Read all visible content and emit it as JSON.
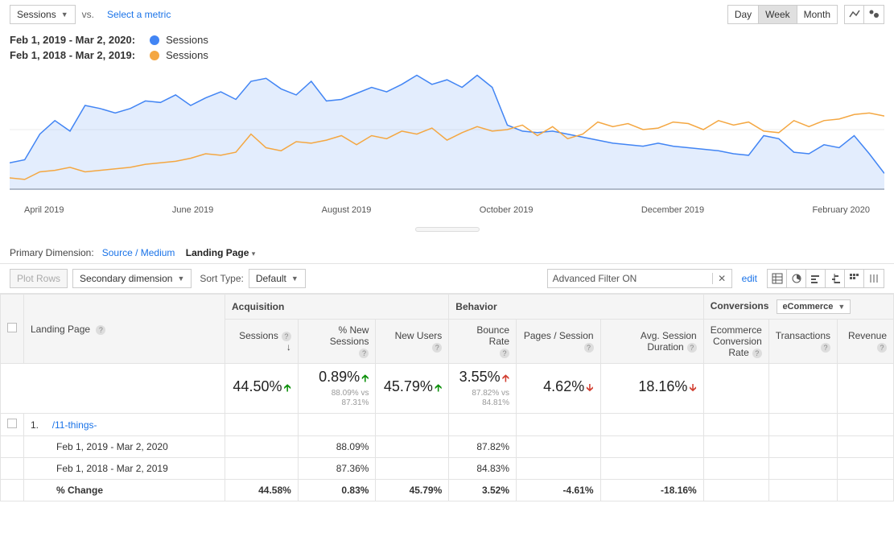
{
  "controls": {
    "metric_dropdown": "Sessions",
    "vs": "vs.",
    "select_metric": "Select a metric",
    "time": {
      "day": "Day",
      "week": "Week",
      "month": "Month",
      "active": "Week"
    }
  },
  "legend": {
    "range_a": "Feb 1, 2019 - Mar 2, 2020:",
    "range_b": "Feb 1, 2018 - Mar 2, 2019:",
    "label_a": "Sessions",
    "label_b": "Sessions",
    "color_a": "#4285f4",
    "color_b": "#f4a742"
  },
  "chart_data": {
    "type": "line",
    "x_ticks": [
      "April 2019",
      "June 2019",
      "August 2019",
      "October 2019",
      "December 2019",
      "February 2020"
    ],
    "series": [
      {
        "name": "Feb 1, 2019 - Mar 2, 2020",
        "color": "#4285f4",
        "values": [
          36,
          40,
          74,
          92,
          78,
          112,
          108,
          102,
          108,
          118,
          116,
          126,
          112,
          122,
          130,
          120,
          144,
          148,
          134,
          126,
          144,
          118,
          120,
          128,
          136,
          130,
          140,
          152,
          140,
          146,
          136,
          152,
          136,
          86,
          78,
          76,
          78,
          74,
          70,
          66,
          62,
          60,
          58,
          62,
          58,
          56,
          54,
          52,
          48,
          46,
          72,
          68,
          50,
          48,
          60,
          56,
          72,
          48,
          22
        ]
      },
      {
        "name": "Feb 1, 2018 - Mar 2, 2019",
        "color": "#f4a742",
        "values": [
          16,
          14,
          24,
          26,
          30,
          24,
          26,
          28,
          30,
          34,
          36,
          38,
          42,
          48,
          46,
          50,
          74,
          56,
          52,
          64,
          62,
          66,
          72,
          60,
          72,
          68,
          78,
          74,
          82,
          66,
          76,
          84,
          78,
          80,
          86,
          72,
          84,
          68,
          74,
          90,
          84,
          88,
          80,
          82,
          90,
          88,
          80,
          92,
          86,
          90,
          78,
          76,
          92,
          84,
          92,
          94,
          100,
          102,
          98
        ]
      }
    ],
    "ylim": [
      0,
      160
    ]
  },
  "dimensions": {
    "primary_label": "Primary Dimension:",
    "source_medium": "Source / Medium",
    "landing_page": "Landing Page"
  },
  "filter_row": {
    "plot_rows": "Plot Rows",
    "secondary_dimension": "Secondary dimension",
    "sort_type": "Sort Type:",
    "sort_default": "Default",
    "advanced_filter": "Advanced Filter ON",
    "edit": "edit"
  },
  "table": {
    "col_landing_page": "Landing Page",
    "group_acq": "Acquisition",
    "group_beh": "Behavior",
    "group_conv": "Conversions",
    "conv_dropdown": "eCommerce",
    "cols": {
      "sessions": "Sessions",
      "pct_new": "% New Sessions",
      "new_users": "New Users",
      "bounce": "Bounce Rate",
      "pages": "Pages / Session",
      "avg_dur": "Avg. Session Duration",
      "ecom_rate": "Ecommerce Conversion Rate",
      "transactions": "Transactions",
      "revenue": "Revenue"
    },
    "summary": {
      "sessions": "44.50%",
      "pct_new": "0.89%",
      "pct_new_sub1": "88.09% vs",
      "pct_new_sub2": "87.31%",
      "new_users": "45.79%",
      "bounce": "3.55%",
      "bounce_sub1": "87.82% vs",
      "bounce_sub2": "84.81%",
      "pages": "4.62%",
      "avg_dur": "18.16%"
    },
    "rows": {
      "r1_num": "1.",
      "r1_path": "/11-things-",
      "r1a_label": "Feb 1, 2019 - Mar 2, 2020",
      "r1a_pct_new": "88.09%",
      "r1a_bounce": "87.82%",
      "r1b_label": "Feb 1, 2018 - Mar 2, 2019",
      "r1b_pct_new": "87.36%",
      "r1b_bounce": "84.83%",
      "r1c_label": "% Change",
      "r1c_sessions": "44.58%",
      "r1c_pct_new": "0.83%",
      "r1c_new_users": "45.79%",
      "r1c_bounce": "3.52%",
      "r1c_pages": "-4.61%",
      "r1c_avg_dur": "-18.16%"
    }
  }
}
